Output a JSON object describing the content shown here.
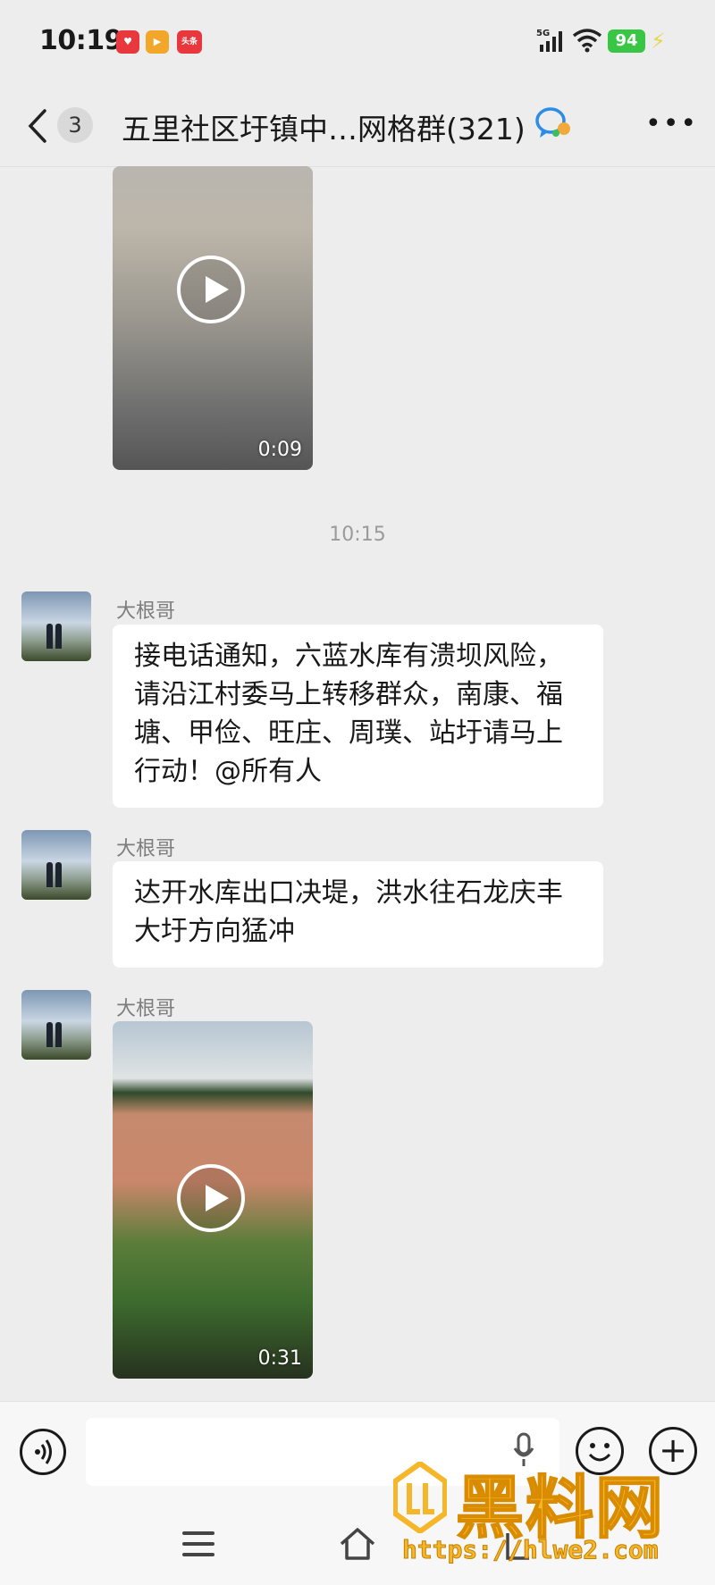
{
  "status_bar": {
    "time": "10:19",
    "app_badges": [
      "red-heart-app-icon",
      "video-app-icon",
      "toutiao-app-icon"
    ],
    "toutiao_label": "头条",
    "network": "5G",
    "battery": "94",
    "battery_color": "#39c645"
  },
  "nav": {
    "unread_count": "3",
    "title": "五里社区圩镇中…网格群(321)"
  },
  "messages": {
    "video_1_duration": "0:09",
    "timestamp": "10:15",
    "msg_1_sender": "大根哥",
    "msg_1_text": "接电话通知，六蓝水库有溃坝风险，请沿江村委马上转移群众，南康、福塘、甲俭、旺庄、周璞、站圩请马上行动！@所有人",
    "msg_2_sender": "大根哥",
    "msg_2_text": "达开水库出口决堤，洪水往石龙庆丰大圩方向猛冲",
    "msg_3_sender": "大根哥",
    "video_2_duration": "0:31"
  },
  "input_bar": {
    "text_value": ""
  },
  "watermark": {
    "brand": "黑料网",
    "url": "https://hlwe2.com"
  },
  "colors": {
    "background": "#ededed",
    "bubble": "#ffffff",
    "accent_watermark": "#f5b62a"
  }
}
